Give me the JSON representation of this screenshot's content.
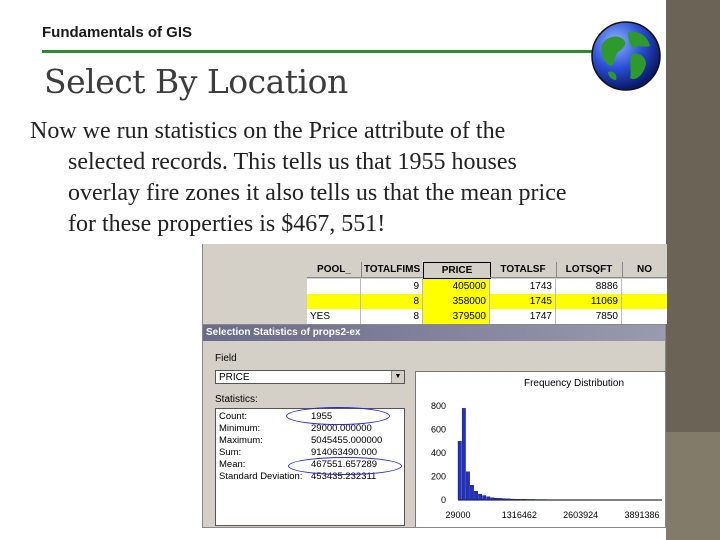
{
  "header": {
    "label": "Fundamentals of GIS",
    "title": "Select By Location"
  },
  "body": {
    "lines": [
      "Now we run statistics on the Price attribute of the",
      "selected records. This tells us that 1955 houses",
      "overlay fire zones  it also tells us that the mean price",
      "for these properties is $467, 551!"
    ]
  },
  "attribute_table": {
    "columns": [
      "POOL_",
      "TOTALFIMS",
      "PRICE",
      "TOTALSF",
      "LOTSQFT",
      "NO"
    ],
    "rows": [
      {
        "pool": "",
        "totalfims": "9",
        "price": "405000",
        "totalsf": "1743",
        "lotsqft": "8886",
        "highlight": false
      },
      {
        "pool": "",
        "totalfims": "8",
        "price": "358000",
        "totalsf": "1745",
        "lotsqft": "11069",
        "highlight": true
      },
      {
        "pool": "YES",
        "totalfims": "8",
        "price": "379500",
        "totalsf": "1747",
        "lotsqft": "7850",
        "highlight": false
      }
    ]
  },
  "dialog": {
    "title": "Selection Statistics of props2-ex",
    "field_label": "Field",
    "field_value": "PRICE",
    "statistics_label": "Statistics:",
    "stats": [
      {
        "name": "Count:",
        "value": "1955"
      },
      {
        "name": "Minimum:",
        "value": "29000.000000"
      },
      {
        "name": "Maximum:",
        "value": "5045455.000000"
      },
      {
        "name": "Sum:",
        "value": "914063490.000"
      },
      {
        "name": "Mean:",
        "value": "467551.657289"
      },
      {
        "name": "Standard Deviation:",
        "value": "453435.232311"
      }
    ]
  },
  "chart_data": {
    "type": "bar",
    "title": "Frequency Distribution",
    "y_ticks": [
      "800",
      "600",
      "400",
      "200",
      "0"
    ],
    "x_ticks": [
      "29000",
      "1316462",
      "2603924",
      "3891386"
    ],
    "ylim": [
      0,
      800
    ],
    "values": [
      500,
      780,
      240,
      125,
      75,
      50,
      38,
      28,
      20,
      16,
      14,
      12,
      10,
      8,
      7,
      6,
      6,
      5,
      5,
      4,
      4,
      4,
      3,
      3,
      3,
      3,
      2,
      2,
      2,
      2,
      2,
      2,
      2,
      1,
      1,
      1,
      1,
      1,
      1,
      1,
      1,
      1,
      1,
      1,
      1,
      1,
      1,
      1,
      1,
      1
    ],
    "bar_color": "#1f2fd0"
  },
  "colors": {
    "accent_rule": "#2c8a2c",
    "side_bar": "#6b6456",
    "highlight_row": "#ffff00",
    "ellipse": "#2b2bd8"
  }
}
